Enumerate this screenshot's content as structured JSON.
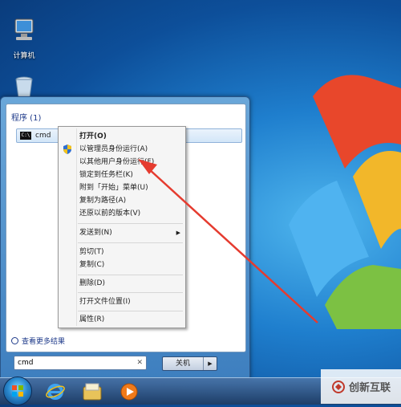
{
  "desktop": {
    "icons": [
      {
        "label": "计算机"
      }
    ]
  },
  "start_menu": {
    "programs_header": "程序 (1)",
    "program_items": [
      {
        "label": "cmd"
      }
    ],
    "more_results": "查看更多结果",
    "search": {
      "value": "cmd"
    },
    "shutdown_label": "关机"
  },
  "context_menu": {
    "items": [
      {
        "label": "打开(O)"
      },
      {
        "label": "以管理员身份运行(A)"
      },
      {
        "label": "以其他用户身份运行(F)"
      },
      {
        "label": "锁定到任务栏(K)"
      },
      {
        "label": "附到「开始」菜单(U)"
      },
      {
        "label": "复制为路径(A)"
      },
      {
        "label": "还原以前的版本(V)"
      },
      {
        "label": "发送到(N)"
      },
      {
        "label": "剪切(T)"
      },
      {
        "label": "复制(C)"
      },
      {
        "label": "删除(D)"
      },
      {
        "label": "打开文件位置(I)"
      },
      {
        "label": "属性(R)"
      }
    ]
  },
  "watermark": "创新互联",
  "colors": {
    "annotation_arrow": "#e53b2f",
    "menu_highlight": "#d3e6f8",
    "link": "#1e3a8a"
  },
  "icons": [
    "computer-icon",
    "recycle-bin-icon",
    "cmd-icon",
    "uac-shield-icon",
    "search-icon",
    "ie-icon",
    "explorer-icon",
    "media-player-icon"
  ]
}
